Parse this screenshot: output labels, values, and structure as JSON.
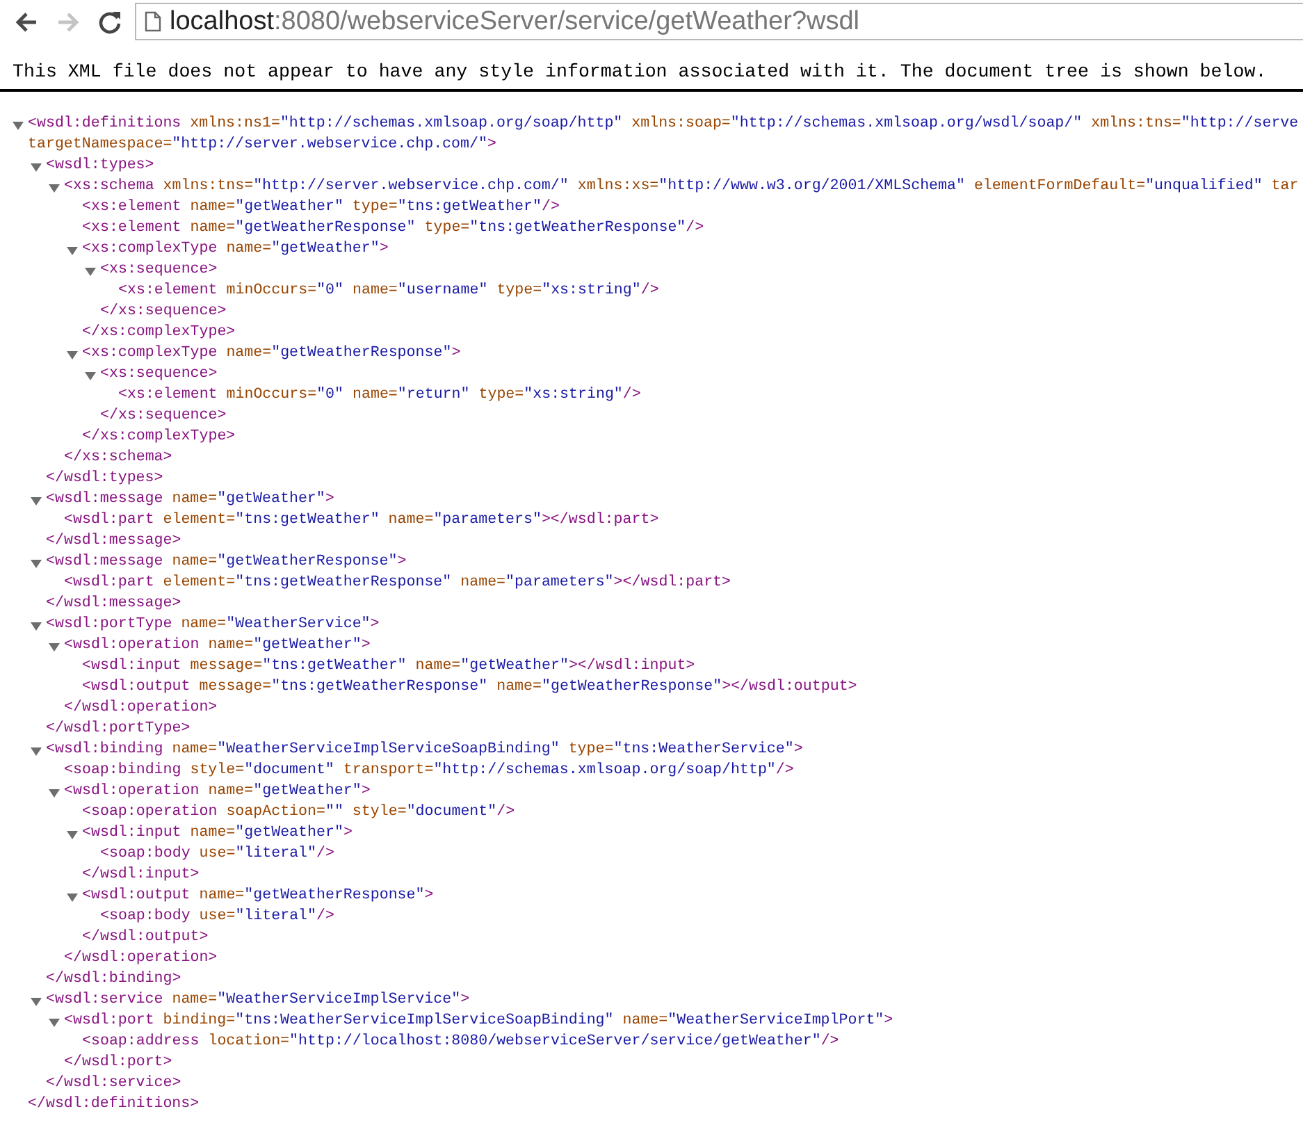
{
  "toolbar": {
    "back_enabled": true,
    "forward_enabled": false,
    "url_host": "localhost",
    "url_rest": ":8080/webserviceServer/service/getWeather?wsdl"
  },
  "notice": "This XML file does not appear to have any style information associated with it. The document tree is shown below.",
  "tree": [
    {
      "kind": "container",
      "expanded": true,
      "open": "<wsdl:definitions",
      "attributes": [
        {
          "name": "xmlns:ns1=",
          "value": "\"http://schemas.xmlsoap.org/soap/http\""
        },
        {
          "name": "xmlns:soap=",
          "value": "\"http://schemas.xmlsoap.org/wsdl/soap/\""
        },
        {
          "name": "xmlns:tns=",
          "value": "\"http://serve"
        },
        {
          "name": "targetNamespace=",
          "value": "\"http://server.webservice.chp.com/\"",
          "wrap": true
        }
      ],
      "end": ">",
      "close": "</wsdl:definitions>",
      "children": [
        {
          "kind": "container",
          "expanded": true,
          "open": "<wsdl:types",
          "end": ">",
          "close": "</wsdl:types>",
          "children": [
            {
              "kind": "container",
              "expanded": true,
              "open": "<xs:schema",
              "attributes": [
                {
                  "name": "xmlns:tns=",
                  "value": "\"http://server.webservice.chp.com/\""
                },
                {
                  "name": "xmlns:xs=",
                  "value": "\"http://www.w3.org/2001/XMLSchema\""
                },
                {
                  "name": "elementFormDefault=",
                  "value": "\"unqualified\""
                },
                {
                  "name": "tar"
                }
              ],
              "close": "</xs:schema>",
              "children": [
                {
                  "kind": "leaf",
                  "open": "<xs:element",
                  "attributes": [
                    {
                      "name": "name=",
                      "value": "\"getWeather\""
                    },
                    {
                      "name": "type=",
                      "value": "\"tns:getWeather\""
                    }
                  ],
                  "end": "/>"
                },
                {
                  "kind": "leaf",
                  "open": "<xs:element",
                  "attributes": [
                    {
                      "name": "name=",
                      "value": "\"getWeatherResponse\""
                    },
                    {
                      "name": "type=",
                      "value": "\"tns:getWeatherResponse\""
                    }
                  ],
                  "end": "/>"
                },
                {
                  "kind": "container",
                  "expanded": true,
                  "open": "<xs:complexType",
                  "attributes": [
                    {
                      "name": "name=",
                      "value": "\"getWeather\""
                    }
                  ],
                  "end": ">",
                  "close": "</xs:complexType>",
                  "children": [
                    {
                      "kind": "container",
                      "expanded": true,
                      "open": "<xs:sequence",
                      "end": ">",
                      "close": "</xs:sequence>",
                      "children": [
                        {
                          "kind": "leaf",
                          "open": "<xs:element",
                          "attributes": [
                            {
                              "name": "minOccurs=",
                              "value": "\"0\""
                            },
                            {
                              "name": "name=",
                              "value": "\"username\""
                            },
                            {
                              "name": "type=",
                              "value": "\"xs:string\""
                            }
                          ],
                          "end": "/>"
                        }
                      ]
                    }
                  ]
                },
                {
                  "kind": "container",
                  "expanded": true,
                  "open": "<xs:complexType",
                  "attributes": [
                    {
                      "name": "name=",
                      "value": "\"getWeatherResponse\""
                    }
                  ],
                  "end": ">",
                  "close": "</xs:complexType>",
                  "children": [
                    {
                      "kind": "container",
                      "expanded": true,
                      "open": "<xs:sequence",
                      "end": ">",
                      "close": "</xs:sequence>",
                      "children": [
                        {
                          "kind": "leaf",
                          "open": "<xs:element",
                          "attributes": [
                            {
                              "name": "minOccurs=",
                              "value": "\"0\""
                            },
                            {
                              "name": "name=",
                              "value": "\"return\""
                            },
                            {
                              "name": "type=",
                              "value": "\"xs:string\""
                            }
                          ],
                          "end": "/>"
                        }
                      ]
                    }
                  ]
                }
              ]
            }
          ]
        },
        {
          "kind": "container",
          "expanded": true,
          "open": "<wsdl:message",
          "attributes": [
            {
              "name": "name=",
              "value": "\"getWeather\""
            }
          ],
          "end": ">",
          "close": "</wsdl:message>",
          "children": [
            {
              "kind": "leaf",
              "open": "<wsdl:part",
              "attributes": [
                {
                  "name": "element=",
                  "value": "\"tns:getWeather\""
                },
                {
                  "name": "name=",
                  "value": "\"parameters\""
                }
              ],
              "end": "></wsdl:part>"
            }
          ]
        },
        {
          "kind": "container",
          "expanded": true,
          "open": "<wsdl:message",
          "attributes": [
            {
              "name": "name=",
              "value": "\"getWeatherResponse\""
            }
          ],
          "end": ">",
          "close": "</wsdl:message>",
          "children": [
            {
              "kind": "leaf",
              "open": "<wsdl:part",
              "attributes": [
                {
                  "name": "element=",
                  "value": "\"tns:getWeatherResponse\""
                },
                {
                  "name": "name=",
                  "value": "\"parameters\""
                }
              ],
              "end": "></wsdl:part>"
            }
          ]
        },
        {
          "kind": "container",
          "expanded": true,
          "open": "<wsdl:portType",
          "attributes": [
            {
              "name": "name=",
              "value": "\"WeatherService\""
            }
          ],
          "end": ">",
          "close": "</wsdl:portType>",
          "children": [
            {
              "kind": "container",
              "expanded": true,
              "open": "<wsdl:operation",
              "attributes": [
                {
                  "name": "name=",
                  "value": "\"getWeather\""
                }
              ],
              "end": ">",
              "close": "</wsdl:operation>",
              "children": [
                {
                  "kind": "leaf",
                  "open": "<wsdl:input",
                  "attributes": [
                    {
                      "name": "message=",
                      "value": "\"tns:getWeather\""
                    },
                    {
                      "name": "name=",
                      "value": "\"getWeather\""
                    }
                  ],
                  "end": "></wsdl:input>"
                },
                {
                  "kind": "leaf",
                  "open": "<wsdl:output",
                  "attributes": [
                    {
                      "name": "message=",
                      "value": "\"tns:getWeatherResponse\""
                    },
                    {
                      "name": "name=",
                      "value": "\"getWeatherResponse\""
                    }
                  ],
                  "end": "></wsdl:output>"
                }
              ]
            }
          ]
        },
        {
          "kind": "container",
          "expanded": true,
          "open": "<wsdl:binding",
          "attributes": [
            {
              "name": "name=",
              "value": "\"WeatherServiceImplServiceSoapBinding\""
            },
            {
              "name": "type=",
              "value": "\"tns:WeatherService\""
            }
          ],
          "end": ">",
          "close": "</wsdl:binding>",
          "children": [
            {
              "kind": "leaf",
              "open": "<soap:binding",
              "attributes": [
                {
                  "name": "style=",
                  "value": "\"document\""
                },
                {
                  "name": "transport=",
                  "value": "\"http://schemas.xmlsoap.org/soap/http\""
                }
              ],
              "end": "/>"
            },
            {
              "kind": "container",
              "expanded": true,
              "open": "<wsdl:operation",
              "attributes": [
                {
                  "name": "name=",
                  "value": "\"getWeather\""
                }
              ],
              "end": ">",
              "close": "</wsdl:operation>",
              "children": [
                {
                  "kind": "leaf",
                  "open": "<soap:operation",
                  "attributes": [
                    {
                      "name": "soapAction=",
                      "value": "\"\""
                    },
                    {
                      "name": "style=",
                      "value": "\"document\""
                    }
                  ],
                  "end": "/>"
                },
                {
                  "kind": "container",
                  "expanded": true,
                  "open": "<wsdl:input",
                  "attributes": [
                    {
                      "name": "name=",
                      "value": "\"getWeather\""
                    }
                  ],
                  "end": ">",
                  "close": "</wsdl:input>",
                  "children": [
                    {
                      "kind": "leaf",
                      "open": "<soap:body",
                      "attributes": [
                        {
                          "name": "use=",
                          "value": "\"literal\""
                        }
                      ],
                      "end": "/>"
                    }
                  ]
                },
                {
                  "kind": "container",
                  "expanded": true,
                  "open": "<wsdl:output",
                  "attributes": [
                    {
                      "name": "name=",
                      "value": "\"getWeatherResponse\""
                    }
                  ],
                  "end": ">",
                  "close": "</wsdl:output>",
                  "children": [
                    {
                      "kind": "leaf",
                      "open": "<soap:body",
                      "attributes": [
                        {
                          "name": "use=",
                          "value": "\"literal\""
                        }
                      ],
                      "end": "/>"
                    }
                  ]
                }
              ]
            }
          ]
        },
        {
          "kind": "container",
          "expanded": true,
          "open": "<wsdl:service",
          "attributes": [
            {
              "name": "name=",
              "value": "\"WeatherServiceImplService\""
            }
          ],
          "end": ">",
          "close": "</wsdl:service>",
          "children": [
            {
              "kind": "container",
              "expanded": true,
              "open": "<wsdl:port",
              "attributes": [
                {
                  "name": "binding=",
                  "value": "\"tns:WeatherServiceImplServiceSoapBinding\""
                },
                {
                  "name": "name=",
                  "value": "\"WeatherServiceImplPort\""
                }
              ],
              "end": ">",
              "close": "</wsdl:port>",
              "children": [
                {
                  "kind": "leaf",
                  "open": "<soap:address",
                  "attributes": [
                    {
                      "name": "location=",
                      "value": "\"http://localhost:8080/webserviceServer/service/getWeather\""
                    }
                  ],
                  "end": "/>"
                }
              ]
            }
          ]
        }
      ]
    }
  ]
}
